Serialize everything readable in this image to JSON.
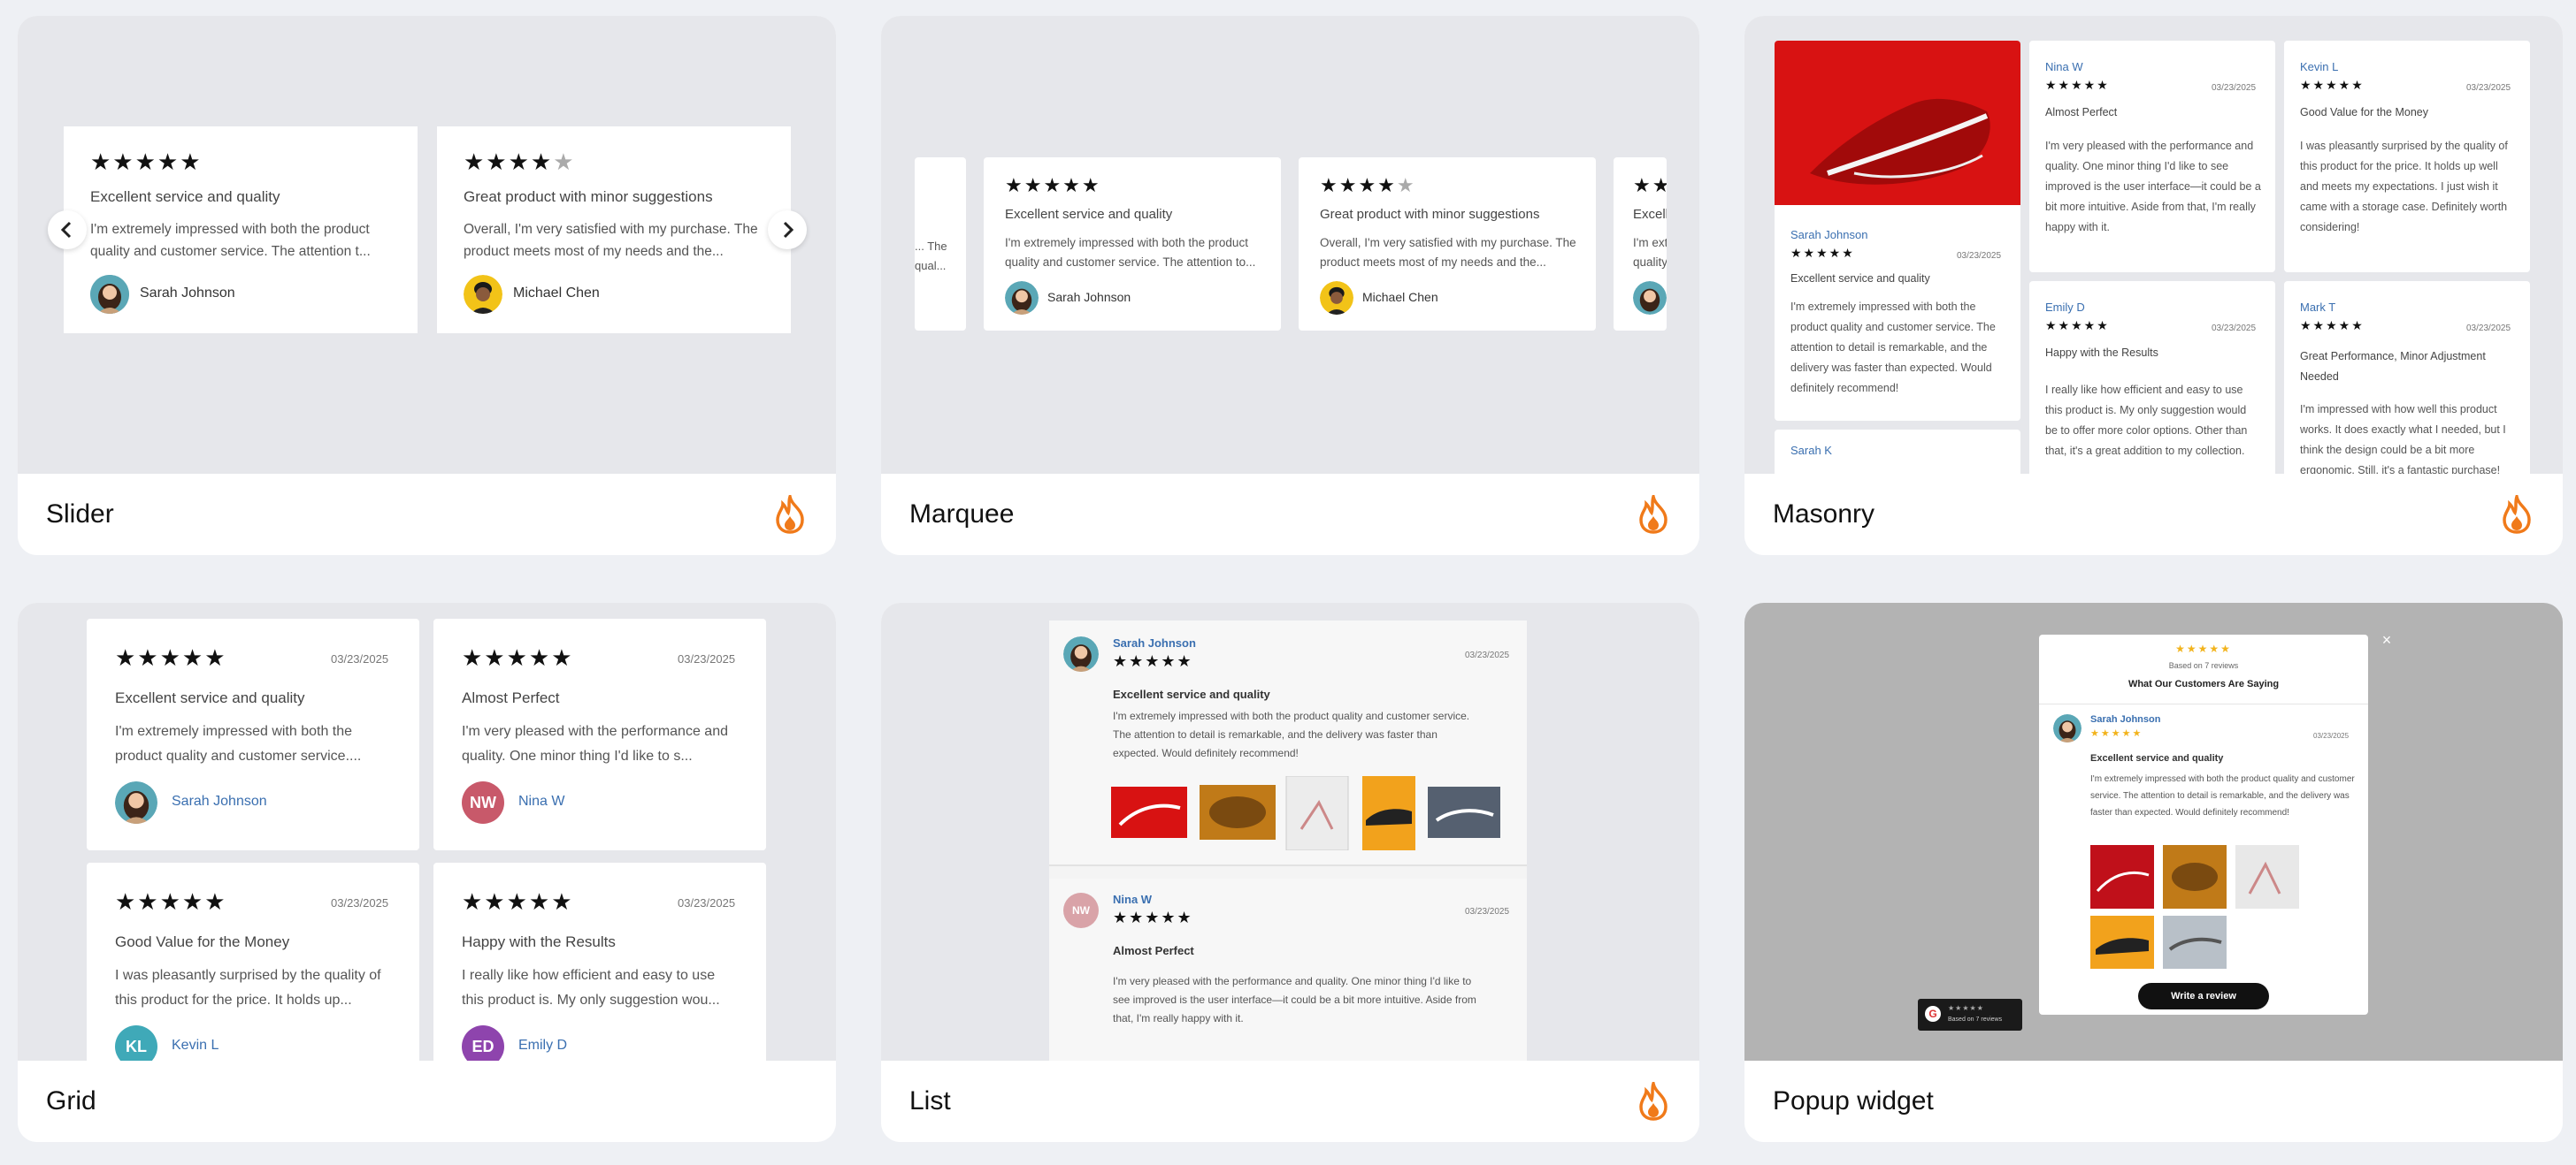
{
  "cards": [
    {
      "label": "Slider",
      "hot": true
    },
    {
      "label": "Marquee",
      "hot": true
    },
    {
      "label": "Masonry",
      "hot": true
    },
    {
      "label": "Grid",
      "hot": false
    },
    {
      "label": "List",
      "hot": true
    },
    {
      "label": "Popup widget",
      "hot": false
    }
  ],
  "stars5": "★★★★★",
  "stars4": "★★★★",
  "star_empty": "★",
  "slider": {
    "r1": {
      "title": "Excellent service and quality",
      "body": "I'm extremely impressed with both the product quality and customer service. The attention t...",
      "name": "Sarah Johnson"
    },
    "r2": {
      "title": "Great product with minor suggestions",
      "body": "Overall, I'm very satisfied with my purchase. The product meets most of my needs and the...",
      "name": "Michael Chen"
    }
  },
  "marquee": {
    "r0": "... The qual...",
    "r1": {
      "title": "Excellent service and quality",
      "body": "I'm extremely impressed with both the product quality and customer service. The attention to...",
      "name": "Sarah Johnson"
    },
    "r2": {
      "title": "Great product with minor suggestions",
      "body": "Overall, I'm very satisfied with my purchase. The product meets most of my needs and the...",
      "name": "Michael Chen"
    },
    "r3": {
      "title": "Excell",
      "body": "I'm ext quality"
    }
  },
  "masonry": {
    "date": "03/23/2025",
    "sarah": {
      "name": "Sarah Johnson",
      "title": "Excellent service and quality",
      "body": "I'm extremely impressed with both the product quality and customer service. The attention to detail is remarkable, and the delivery was faster than expected. Would definitely recommend!"
    },
    "sarahk": {
      "name": "Sarah K"
    },
    "nina": {
      "name": "Nina W",
      "title": "Almost Perfect",
      "body": "I'm very pleased with the performance and quality. One minor thing I'd like to see improved is the user interface—it could be a bit more intuitive. Aside from that, I'm really happy with it."
    },
    "kevin": {
      "name": "Kevin L",
      "title": "Good Value for the Money",
      "body": "I was pleasantly surprised by the quality of this product for the price. It holds up well and meets my expectations. I just wish it came with a storage case. Definitely worth considering!"
    },
    "emily": {
      "name": "Emily D",
      "title": "Happy with the Results",
      "body": "I really like how efficient and easy to use this product is. My only suggestion would be to offer more color options. Other than that, it's a great addition to my collection."
    },
    "mark": {
      "name": "Mark T",
      "title": "Great Performance, Minor Adjustment Needed",
      "body": "I'm impressed with how well this product works. It does exactly what I needed, but I think the design could be a bit more ergonomic. Still, it's a fantastic purchase!"
    }
  },
  "grid": {
    "date": "03/23/2025",
    "r1": {
      "title": "Excellent service and quality",
      "body": "I'm extremely impressed with both the product quality and customer service....",
      "name": "Sarah Johnson"
    },
    "r2": {
      "title": "Almost Perfect",
      "body": "I'm very pleased with the performance and quality. One minor thing I'd like to s...",
      "name": "Nina W",
      "ini": "NW"
    },
    "r3": {
      "title": "Good Value for the Money",
      "body": "I was pleasantly surprised by the quality of this product for the price. It holds up...",
      "name": "Kevin L",
      "ini": "KL"
    },
    "r4": {
      "title": "Happy with the Results",
      "body": "I really like how efficient and easy to use this product is. My only suggestion wou...",
      "name": "Emily D",
      "ini": "ED"
    }
  },
  "list": {
    "date": "03/23/2025",
    "r1": {
      "name": "Sarah Johnson",
      "title": "Excellent service and quality",
      "body": "I'm extremely impressed with both the product quality and customer service. The attention to detail is remarkable, and the delivery was faster than expected. Would definitely recommend!"
    },
    "r2": {
      "name": "Nina W",
      "ini": "NW",
      "title": "Almost Perfect",
      "body": "I'm very pleased with the performance and quality. One minor thing I'd like to see improved is the user interface—it could be a bit more intuitive. Aside from that, I'm really happy with it."
    }
  },
  "popup": {
    "close": "×",
    "based": "Based on 7 reviews",
    "heading": "What Our Customers Are Saying",
    "name": "Sarah Johnson",
    "date": "03/23/2025",
    "title": "Excellent service and quality",
    "body": "I'm extremely impressed with both the product quality and customer service. The attention to detail is remarkable, and the delivery was faster than expected. Would definitely recommend!",
    "cta": "Write a review",
    "badge_g": "G",
    "badge_text": "Based on 7 reviews"
  },
  "colors": {
    "flame": "#f07a1a",
    "star_gold": "#f2b31c",
    "link_blue": "#3a6fb0"
  }
}
